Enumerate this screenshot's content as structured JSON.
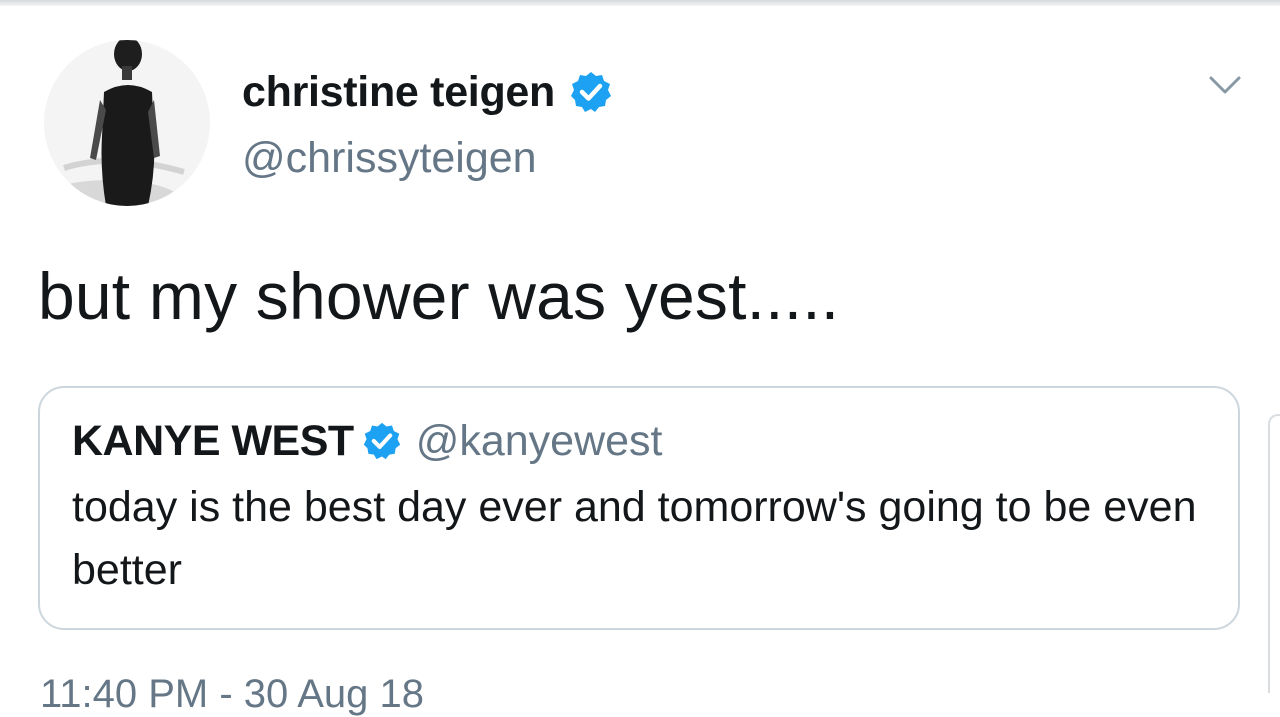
{
  "tweet": {
    "author": {
      "name": "christine teigen",
      "handle": "@chrissyteigen",
      "verified": true
    },
    "text": "but my shower was yest.....",
    "timestamp": "11:40 PM - 30 Aug 18"
  },
  "quoted_tweet": {
    "author": {
      "name": "KANYE WEST",
      "handle": "@kanyewest",
      "verified": true
    },
    "text": "today is the best day ever and tomorrow's going to be even better"
  },
  "colors": {
    "text": "#14171a",
    "secondary": "#657786",
    "verified_blue": "#1da1f2",
    "border": "#ccd6dd"
  },
  "icons": {
    "verified": "verified-badge-icon",
    "menu": "chevron-down-icon"
  }
}
